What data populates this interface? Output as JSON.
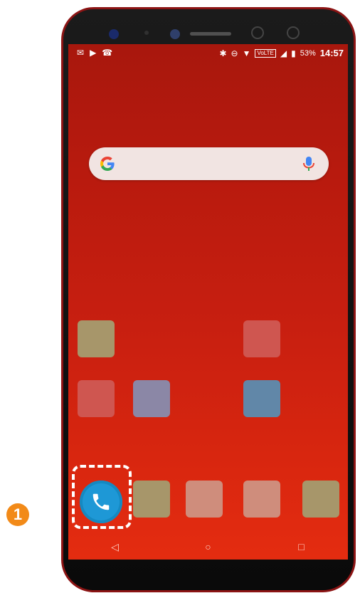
{
  "statusbar": {
    "left_icons": [
      "gmail-icon",
      "youtube-icon",
      "missed-call-icon"
    ],
    "volte": "VoLTE",
    "battery": "53%",
    "time": "14:57"
  },
  "search": {
    "placeholder": "",
    "logo": "google-g-icon",
    "voice": "mic-icon"
  },
  "dock": {
    "phone_app": "phone-icon"
  },
  "step": {
    "label": "1"
  },
  "nav": {
    "back": "◁",
    "home": "○",
    "recents": "□"
  }
}
